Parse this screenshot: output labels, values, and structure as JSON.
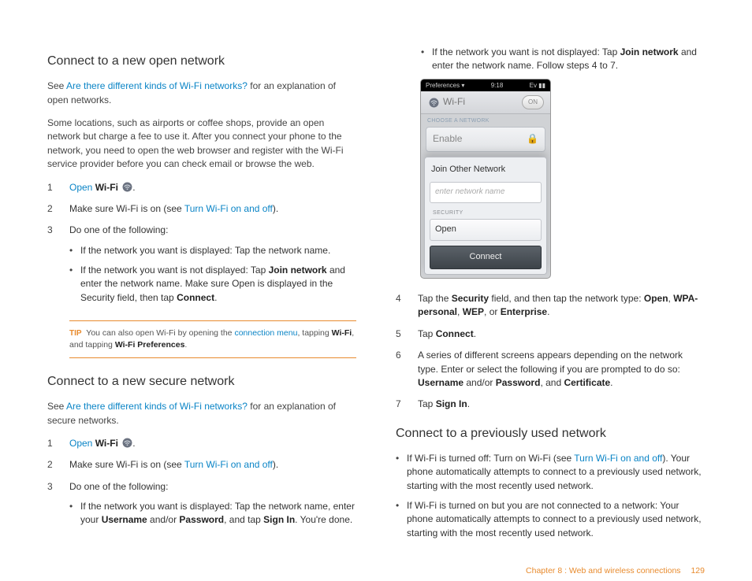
{
  "leftCol": {
    "section1": {
      "title": "Connect to a new open network",
      "intro_pre": "See ",
      "intro_link": "Are there different kinds of Wi-Fi networks?",
      "intro_post": " for an explanation of open networks.",
      "para2": "Some locations, such as airports or coffee shops, provide an open network but charge a fee to use it. After you connect your phone to the network, you need to open the web browser and register with the Wi-Fi service provider before you can check email or browse the web.",
      "step1_num": "1",
      "step1_open": "Open",
      "step1_wifi": "Wi-Fi",
      "step1_dot": ".",
      "step2_num": "2",
      "step2_pre": "Make sure Wi-Fi is on (see ",
      "step2_link": "Turn Wi-Fi on and off",
      "step2_post": ").",
      "step3_num": "3",
      "step3_text": "Do one of the following:",
      "step3_b1": "If the network you want is displayed: Tap the network name.",
      "step3_b2_pre": "If the network you want is not displayed: Tap ",
      "step3_b2_bold1": "Join network",
      "step3_b2_mid": " and enter the network name. Make sure Open is displayed in the Security field, then tap ",
      "step3_b2_bold2": "Connect",
      "step3_b2_end": ".",
      "tip_label": "TIP",
      "tip_pre": "  You can also open Wi-Fi by opening the ",
      "tip_link": "connection menu",
      "tip_mid": ", tapping ",
      "tip_bold1": "Wi-Fi",
      "tip_mid2": ", and tapping ",
      "tip_bold2": "Wi-Fi Preferences",
      "tip_end": "."
    },
    "section2": {
      "title": "Connect to a new secure network",
      "intro_pre": "See ",
      "intro_link": "Are there different kinds of Wi-Fi networks?",
      "intro_post": " for an explanation of secure networks.",
      "step1_num": "1",
      "step1_open": "Open",
      "step1_wifi": "Wi-Fi",
      "step1_dot": ".",
      "step2_num": "2",
      "step2_pre": "Make sure Wi-Fi is on (see ",
      "step2_link": "Turn Wi-Fi on and off",
      "step2_post": ").",
      "step3_num": "3",
      "step3_text": "Do one of the following:",
      "step3_b1_pre": "If the network you want is displayed: Tap the network name, enter your ",
      "step3_b1_bold1": "Username",
      "step3_b1_mid1": " and/or ",
      "step3_b1_bold2": "Password",
      "step3_b1_mid2": ", and tap ",
      "step3_b1_bold3": "Sign In",
      "step3_b1_end": ". You're done."
    }
  },
  "rightCol": {
    "top_bullet_pre": "If the network you want is not displayed: Tap ",
    "top_bullet_bold": "Join network",
    "top_bullet_post": " and enter the network name. Follow steps 4 to 7.",
    "phone": {
      "status_left": "Preferences ▾",
      "status_time": "9:18",
      "status_right": "Ev ▮▮",
      "wifi_label": "Wi-Fi",
      "on_label": "ON",
      "choose_label": "CHOOSE A NETWORK",
      "enable_row": "Enable",
      "modal_title": "Join Other Network",
      "input_placeholder": "enter network name",
      "security_label": "SECURITY",
      "security_value": "Open",
      "connect_label": "Connect"
    },
    "step4_num": "4",
    "step4_pre": "Tap the ",
    "step4_bold1": "Security",
    "step4_mid1": " field, and then tap the network type: ",
    "step4_bold2": "Open",
    "step4_c1": ", ",
    "step4_bold3": "WPA-personal",
    "step4_c2": ", ",
    "step4_bold4": "WEP",
    "step4_c3": ", or ",
    "step4_bold5": "Enterprise",
    "step4_end": ".",
    "step5_num": "5",
    "step5_pre": "Tap ",
    "step5_bold": "Connect",
    "step5_end": ".",
    "step6_num": "6",
    "step6_pre": "A series of different screens appears depending on the network type. Enter or select the following if you are prompted to do so: ",
    "step6_bold1": "Username",
    "step6_mid1": " and/or ",
    "step6_bold2": "Password",
    "step6_mid2": ", and ",
    "step6_bold3": "Certificate",
    "step6_end": ".",
    "step7_num": "7",
    "step7_pre": "Tap ",
    "step7_bold": "Sign In",
    "step7_end": ".",
    "section3": {
      "title": "Connect to a previously used network",
      "b1_pre": "If Wi-Fi is turned off: Turn on Wi-Fi (see ",
      "b1_link": "Turn Wi-Fi on and off",
      "b1_post": "). Your phone automatically attempts to connect to a previously used network, starting with the most recently used network.",
      "b2": "If Wi-Fi is turned on but you are not connected to a network: Your phone automatically attempts to connect to a previously used network, starting with the most recently used network."
    }
  },
  "footer": {
    "chapter": "Chapter 8 : Web and wireless connections",
    "page": "129"
  }
}
